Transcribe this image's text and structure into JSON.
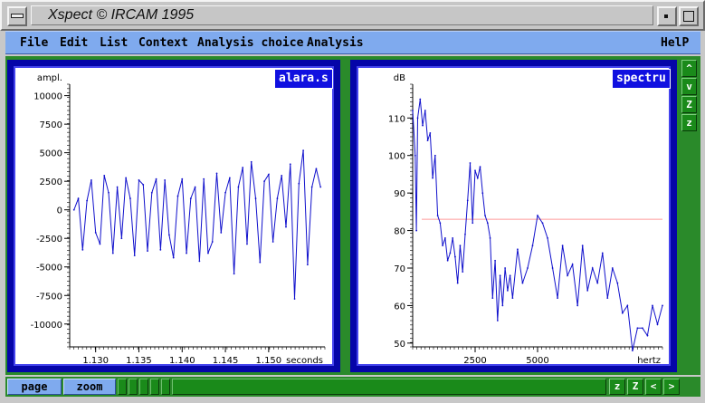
{
  "window": {
    "title": "Xspect © IRCAM 1995"
  },
  "menu": {
    "items": [
      "File",
      "Edit",
      "List",
      "Context",
      "Analysis choice",
      "Analysis"
    ],
    "help": "HelP"
  },
  "left_panel": {
    "tag": "alara.s"
  },
  "right_panel": {
    "tag": "spectru"
  },
  "side_buttons": [
    "^",
    "v",
    "Z",
    "z"
  ],
  "bottom": {
    "page": "page",
    "zoom": "zoom",
    "nav": [
      "z",
      "Z",
      "<",
      ">"
    ]
  },
  "colors": {
    "menu": "#7faaee",
    "panel_frame": "#0505a8",
    "workspace": "#2a8a2a",
    "trace": "#1010cc",
    "reference_line": "#ff9a9a"
  },
  "chart_data": [
    {
      "type": "line",
      "title": "",
      "xlabel": "seconds",
      "ylabel": "ampl.",
      "xlim": [
        1.127,
        1.1565
      ],
      "ylim": [
        -12000,
        11000
      ],
      "xticks": [
        1.13,
        1.135,
        1.14,
        1.145,
        1.15
      ],
      "xtick_labels": [
        "1.130",
        "1.135",
        "1.140",
        "1.145",
        "1.150"
      ],
      "yticks": [
        10000,
        7500,
        5000,
        2500,
        0,
        -2500,
        -5000,
        -7500,
        -10000
      ],
      "ytick_labels": [
        "10000",
        "7500",
        "5000",
        "2500",
        "0",
        "-2500",
        "-5000",
        "-7500",
        "-10000"
      ],
      "x": [
        1.1275,
        1.128,
        1.1285,
        1.129,
        1.1295,
        1.13,
        1.1305,
        1.131,
        1.1315,
        1.132,
        1.1325,
        1.133,
        1.1335,
        1.134,
        1.1345,
        1.135,
        1.1355,
        1.136,
        1.1365,
        1.137,
        1.1375,
        1.138,
        1.1385,
        1.139,
        1.1395,
        1.14,
        1.1405,
        1.141,
        1.1415,
        1.142,
        1.1425,
        1.143,
        1.1435,
        1.144,
        1.1445,
        1.145,
        1.1455,
        1.146,
        1.1465,
        1.147,
        1.1475,
        1.148,
        1.1485,
        1.149,
        1.1495,
        1.15,
        1.1505,
        1.151,
        1.1515,
        1.152,
        1.1525,
        1.153,
        1.1535,
        1.154,
        1.1545,
        1.155,
        1.1555,
        1.156
      ],
      "y": [
        0,
        1000,
        -3500,
        800,
        2600,
        -2000,
        -3000,
        3000,
        1500,
        -3800,
        2000,
        -2500,
        2800,
        1000,
        -4000,
        2600,
        2200,
        -3600,
        1500,
        2700,
        -3500,
        2600,
        -2200,
        -4200,
        1200,
        2700,
        -3800,
        1000,
        2000,
        -4500,
        2700,
        -3800,
        -2800,
        3200,
        -2000,
        1500,
        2800,
        -5600,
        2000,
        3700,
        -3000,
        4200,
        1000,
        -4600,
        2500,
        3100,
        -2800,
        1000,
        3000,
        -1500,
        4000,
        -7800,
        2300,
        5200,
        -4800,
        2000,
        3600,
        2000
      ]
    },
    {
      "type": "line",
      "title": "",
      "xlabel": "hertz",
      "ylabel": "dB",
      "xlim": [
        0,
        10000
      ],
      "ylim": [
        49,
        119
      ],
      "xticks": [
        2500,
        5000
      ],
      "xtick_labels": [
        "2500",
        "5000"
      ],
      "yticks": [
        110,
        100,
        90,
        80,
        70,
        60,
        50
      ],
      "ytick_labels": [
        "110",
        "100",
        "90",
        "80",
        "70",
        "60",
        "50"
      ],
      "reference_line_db": 83,
      "x": [
        0,
        100,
        150,
        200,
        300,
        400,
        500,
        600,
        700,
        800,
        900,
        1000,
        1100,
        1200,
        1300,
        1400,
        1500,
        1600,
        1700,
        1800,
        1900,
        2000,
        2100,
        2200,
        2300,
        2400,
        2500,
        2600,
        2700,
        2800,
        2900,
        3000,
        3100,
        3200,
        3300,
        3400,
        3500,
        3600,
        3700,
        3800,
        3900,
        4000,
        4200,
        4400,
        4600,
        4800,
        5000,
        5200,
        5400,
        5600,
        5800,
        6000,
        6200,
        6400,
        6600,
        6800,
        7000,
        7200,
        7400,
        7600,
        7800,
        8000,
        8200,
        8400,
        8600,
        8800,
        9000,
        9200,
        9400,
        9600,
        9800,
        10000
      ],
      "y": [
        112,
        100,
        80,
        110,
        115,
        108,
        112,
        104,
        106,
        94,
        100,
        84,
        82,
        76,
        78,
        72,
        74,
        78,
        73,
        66,
        76,
        69,
        79,
        88,
        98,
        82,
        96,
        94,
        97,
        90,
        84,
        82,
        78,
        62,
        72,
        56,
        68,
        60,
        70,
        64,
        68,
        62,
        75,
        66,
        70,
        76,
        84,
        82,
        78,
        70,
        62,
        76,
        68,
        71,
        60,
        76,
        64,
        70,
        66,
        74,
        62,
        70,
        66,
        58,
        60,
        48,
        54,
        54,
        52,
        60,
        55,
        60
      ]
    }
  ]
}
